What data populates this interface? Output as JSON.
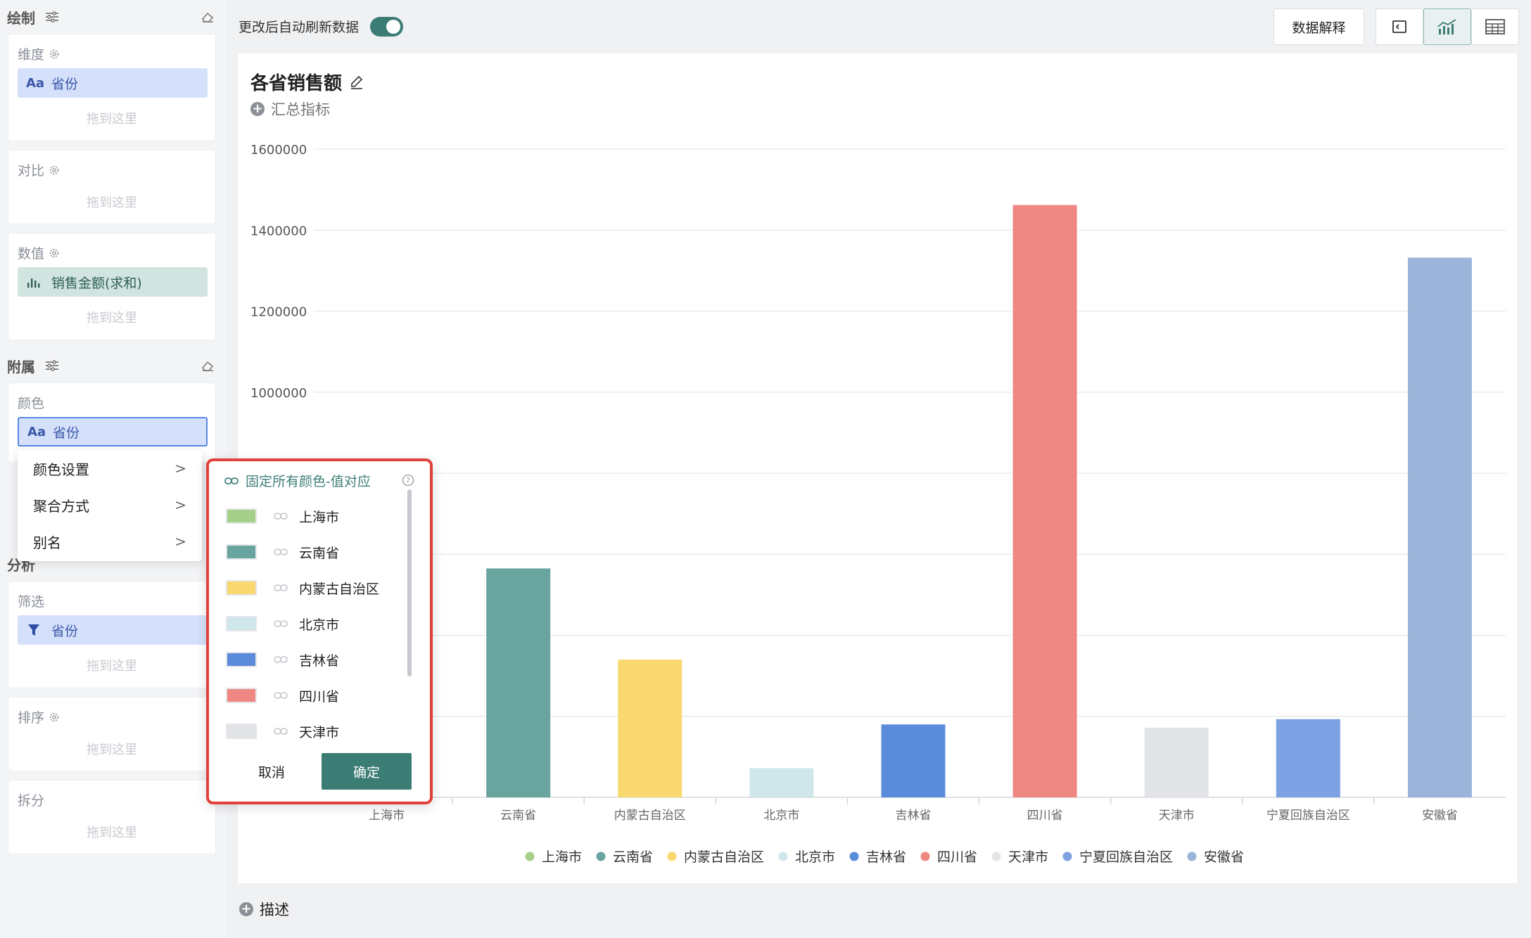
{
  "left": {
    "draw_title": "绘制",
    "dimension": {
      "title": "维度",
      "field": "省份",
      "field_icon": "Aa",
      "drop": "拖到这里"
    },
    "compare": {
      "title": "对比",
      "drop": "拖到这里"
    },
    "value": {
      "title": "数值",
      "field": "销售金额(求和)",
      "drop": "拖到这里"
    },
    "attach_title": "附属",
    "color": {
      "title": "颜色",
      "field": "省份",
      "field_icon": "Aa"
    },
    "analysis_title": "分析",
    "filter": {
      "title": "筛选",
      "field": "省份",
      "drop": "拖到这里"
    },
    "sort": {
      "title": "排序",
      "drop": "拖到这里"
    },
    "split": {
      "title": "拆分",
      "drop": "拖到这里"
    }
  },
  "context_menu": {
    "items": [
      {
        "label": "颜色设置",
        "arrow": ">"
      },
      {
        "label": "聚合方式",
        "arrow": ">"
      },
      {
        "label": "别名",
        "arrow": ">"
      }
    ]
  },
  "color_popup": {
    "header": "固定所有颜色-值对应",
    "rows": [
      {
        "name": "上海市",
        "color": "#a5d08a"
      },
      {
        "name": "云南省",
        "color": "#6aa49f"
      },
      {
        "name": "内蒙古自治区",
        "color": "#f9d86f"
      },
      {
        "name": "北京市",
        "color": "#cfe7ea"
      },
      {
        "name": "吉林省",
        "color": "#5b8cdc"
      },
      {
        "name": "四川省",
        "color": "#ef8783"
      },
      {
        "name": "天津市",
        "color": "#e3e4e7"
      }
    ],
    "cancel": "取消",
    "ok": "确定"
  },
  "topbar": {
    "auto_refresh_label": "更改后自动刷新数据",
    "auto_refresh_on": true,
    "explain_button": "数据解释"
  },
  "chart_title": "各省销售额",
  "summary_label": "汇总指标",
  "describe_label": "描述",
  "chart_data": {
    "type": "bar",
    "ylim": [
      0,
      1600000
    ],
    "yticks": [
      1600000,
      1400000,
      1200000,
      1000000
    ],
    "categories": [
      "上海市",
      "云南省",
      "内蒙古自治区",
      "北京市",
      "吉林省",
      "四川省",
      "天津市",
      "宁夏回族自治区",
      "安徽省"
    ],
    "values": [
      0,
      565000,
      340000,
      72000,
      180000,
      1462000,
      172000,
      193000,
      1332000
    ],
    "colors": [
      "#a5d08a",
      "#6aa49f",
      "#f9d86f",
      "#cfe7ea",
      "#5b8cdc",
      "#ef8783",
      "#e3e4e7",
      "#7da1e3",
      "#9bb4d9"
    ],
    "legend": [
      "上海市",
      "云南省",
      "内蒙古自治区",
      "北京市",
      "吉林省",
      "四川省",
      "天津市",
      "宁夏回族自治区",
      "安徽省"
    ],
    "legend_position": "bottom",
    "grid": true
  }
}
